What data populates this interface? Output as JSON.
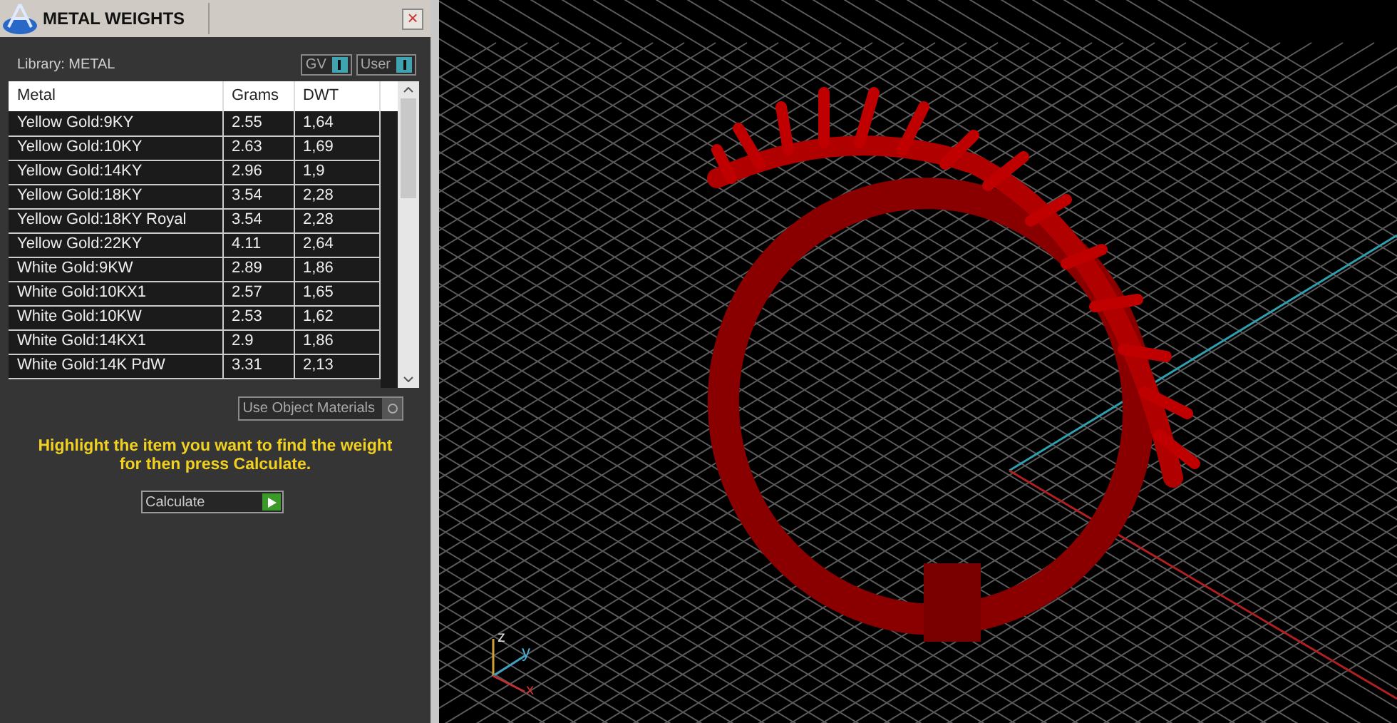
{
  "panel": {
    "title": "METAL WEIGHTS",
    "close": "×",
    "library": "Library: METAL",
    "toggles": [
      {
        "label": "GV",
        "on": true
      },
      {
        "label": "User",
        "on": true
      }
    ],
    "table": {
      "columns": [
        "Metal",
        "Grams",
        "DWT"
      ],
      "rows": [
        {
          "cells": [
            "Yellow Gold:9KY",
            "2.55",
            "1,64"
          ]
        },
        {
          "cells": [
            "Yellow Gold:10KY",
            "2.63",
            "1,69"
          ]
        },
        {
          "cells": [
            "Yellow Gold:14KY",
            "2.96",
            "1,9"
          ]
        },
        {
          "cells": [
            "Yellow Gold:18KY",
            "3.54",
            "2,28"
          ]
        },
        {
          "cells": [
            "Yellow Gold:18KY Royal",
            "3.54",
            "2,28"
          ]
        },
        {
          "cells": [
            "Yellow Gold:22KY",
            "4.11",
            "2,64"
          ]
        },
        {
          "cells": [
            "White Gold:9KW",
            "2.89",
            "1,86"
          ]
        },
        {
          "cells": [
            "White Gold:10KX1",
            "2.57",
            "1,65"
          ]
        },
        {
          "cells": [
            "White Gold:10KW",
            "2.53",
            "1,62"
          ]
        },
        {
          "cells": [
            "White Gold:14KX1",
            "2.9",
            "1,86"
          ]
        },
        {
          "cells": [
            "White Gold:14K PdW",
            "3.31",
            "2,13"
          ]
        }
      ]
    },
    "use_object_materials": {
      "label": "Use Object Materials",
      "checked": false
    },
    "hint": "Highlight the item you want to find the weight for then press Calculate.",
    "calculate": "Calculate"
  },
  "viewport": {
    "axes": [
      "z",
      "y",
      "x"
    ]
  }
}
